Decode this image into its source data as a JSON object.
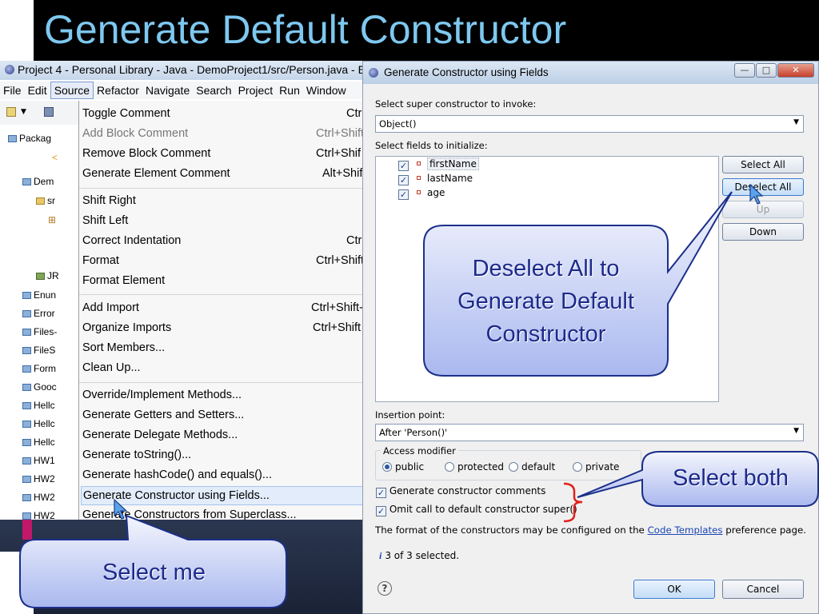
{
  "slide": {
    "title": "Generate Default Constructor",
    "callouts": [
      "Deselect All to Generate Default Constructor",
      "Select both",
      "Select me"
    ]
  },
  "eclipse": {
    "window_title": "Project 4 - Personal Library - Java - DemoProject1/src/Person.java - Ec",
    "menubar": [
      "File",
      "Edit",
      "Source",
      "Refactor",
      "Navigate",
      "Search",
      "Project",
      "Run",
      "Window"
    ],
    "active_menu": "Source",
    "left_pane": {
      "tab": "Packag",
      "items": [
        "Dem",
        "sr",
        "JR",
        "Enun",
        "Error",
        "Files-",
        "FileS",
        "Form",
        "Gooc",
        "Hellc",
        "Hellc",
        "Hellc",
        "HW1",
        "HW2",
        "HW2",
        "HW2"
      ]
    },
    "source_menu": [
      {
        "label": "Toggle Comment",
        "shortcut": "Ctrl"
      },
      {
        "label": "Add Block Comment",
        "shortcut": "Ctrl+Shift"
      },
      {
        "label": "Remove Block Comment",
        "shortcut": "Ctrl+Shif"
      },
      {
        "label": "Generate Element Comment",
        "shortcut": "Alt+Shif"
      },
      {
        "label": "Shift Right",
        "shortcut": ""
      },
      {
        "label": "Shift Left",
        "shortcut": ""
      },
      {
        "label": "Correct Indentation",
        "shortcut": "Ctr"
      },
      {
        "label": "Format",
        "shortcut": "Ctrl+Shift"
      },
      {
        "label": "Format Element",
        "shortcut": ""
      },
      {
        "label": "Add Import",
        "shortcut": "Ctrl+Shift-"
      },
      {
        "label": "Organize Imports",
        "shortcut": "Ctrl+Shift"
      },
      {
        "label": "Sort Members...",
        "shortcut": ""
      },
      {
        "label": "Clean Up...",
        "shortcut": ""
      },
      {
        "label": "Override/Implement Methods...",
        "shortcut": ""
      },
      {
        "label": "Generate Getters and Setters...",
        "shortcut": ""
      },
      {
        "label": "Generate Delegate Methods...",
        "shortcut": ""
      },
      {
        "label": "Generate toString()...",
        "shortcut": ""
      },
      {
        "label": "Generate hashCode() and equals()...",
        "shortcut": ""
      },
      {
        "label": "Generate Constructor using Fields...",
        "shortcut": ""
      },
      {
        "label": "Generate Constructors from Superclass...",
        "shortcut": ""
      }
    ]
  },
  "dialog": {
    "title": "Generate Constructor using Fields",
    "super_label": "Select super constructor to invoke:",
    "super_value": "Object()",
    "fields_label": "Select fields to initialize:",
    "fields": [
      {
        "name": "firstName",
        "checked": true
      },
      {
        "name": "lastName",
        "checked": true
      },
      {
        "name": "age",
        "checked": true
      }
    ],
    "buttons_side": [
      "Select All",
      "Deselect All",
      "Up",
      "Down"
    ],
    "insertion_label": "Insertion point:",
    "insertion_value": "After 'Person()'",
    "access_label": "Access modifier",
    "access_options": [
      "public",
      "protected",
      "default",
      "private"
    ],
    "access_selected": "public",
    "option_comments": "Generate constructor comments",
    "option_omit_super": "Omit call to default constructor super()",
    "format_text_before": "The format of the constructors may be configured on the ",
    "format_link": "Code Templates",
    "format_text_after": " preference page.",
    "status": "3 of 3 selected.",
    "ok_label": "OK",
    "cancel_label": "Cancel"
  }
}
